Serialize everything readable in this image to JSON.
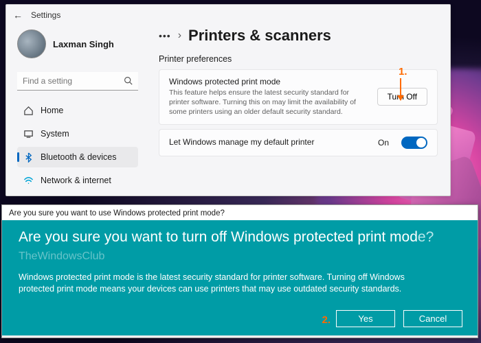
{
  "window": {
    "title": "Settings"
  },
  "user": {
    "name": "Laxman Singh"
  },
  "search": {
    "placeholder": "Find a setting"
  },
  "nav": {
    "home": "Home",
    "system": "System",
    "bluetooth": "Bluetooth & devices",
    "network": "Network & internet"
  },
  "breadcrumb": {
    "dots": "•••",
    "sep": "›",
    "title": "Printers & scanners"
  },
  "section": {
    "prefs": "Printer preferences"
  },
  "card1": {
    "title": "Windows protected print mode",
    "desc": "This feature helps ensure the latest security standard for printer software. Turning this on may limit the availability of some printers using an older default security standard.",
    "button": "Turn Off"
  },
  "card2": {
    "title": "Let Windows manage my default printer",
    "state": "On"
  },
  "annotations": {
    "one": "1.",
    "two": "2."
  },
  "dialog": {
    "titlebar": "Are you sure you want to use Windows protected print mode?",
    "heading_a": "Are you sure you want to turn off Windows protected print mod",
    "heading_q": "e?",
    "watermark": "TheWindowsClub",
    "body": "Windows protected print mode is the latest security standard for printer software. Turning off Windows protected print mode means your devices can use printers that may use outdated security standards.",
    "yes": "Yes",
    "cancel": "Cancel"
  }
}
